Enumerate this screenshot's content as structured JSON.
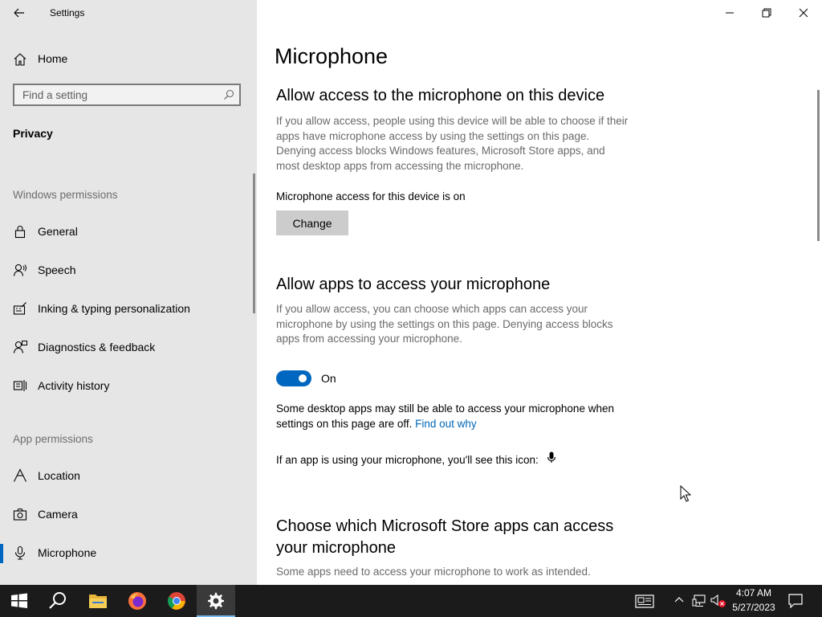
{
  "window": {
    "title": "Settings"
  },
  "sidebar": {
    "home_label": "Home",
    "search_placeholder": "Find a setting",
    "section_label": "Privacy",
    "group_windows": "Windows permissions",
    "group_apps": "App permissions",
    "windows_items": [
      {
        "label": "General",
        "icon": "lock-icon"
      },
      {
        "label": "Speech",
        "icon": "speech-icon"
      },
      {
        "label": "Inking & typing personalization",
        "icon": "inking-icon"
      },
      {
        "label": "Diagnostics & feedback",
        "icon": "diagnostics-icon"
      },
      {
        "label": "Activity history",
        "icon": "activity-history-icon"
      }
    ],
    "app_items": [
      {
        "label": "Location",
        "icon": "location-icon"
      },
      {
        "label": "Camera",
        "icon": "camera-icon"
      },
      {
        "label": "Microphone",
        "icon": "microphone-icon",
        "selected": true
      }
    ]
  },
  "main": {
    "page_title": "Microphone",
    "device_section": {
      "heading": "Allow access to the microphone on this device",
      "description": "If you allow access, people using this device will be able to choose if their apps have microphone access by using the settings on this page. Denying access blocks Windows features, Microsoft Store apps, and most desktop apps from accessing the microphone.",
      "status": "Microphone access for this device is on",
      "change_label": "Change"
    },
    "apps_section": {
      "heading": "Allow apps to access your microphone",
      "description": "If you allow access, you can choose which apps can access your microphone by using the settings on this page. Denying access blocks apps from accessing your microphone.",
      "toggle_state": "On",
      "toggle_on": true,
      "desktop_note": "Some desktop apps may still be able to access your microphone when settings on this page are off.",
      "find_out_link": "Find out why",
      "icon_note": "If an app is using your microphone, you'll see this icon:"
    },
    "store_section": {
      "heading_line1": "Choose which Microsoft Store apps can access",
      "heading_line2": "your microphone",
      "description": "Some apps need to access your microphone to work as intended."
    }
  },
  "taskbar": {
    "apps": [
      "start-button",
      "search-button",
      "file-explorer",
      "firefox",
      "chrome",
      "settings"
    ],
    "time": "4:07 AM",
    "date": "5/27/2023"
  },
  "colors": {
    "accent": "#0067c0",
    "link": "#0067b8",
    "sidebar_bg": "#e6e6e6",
    "taskbar_bg": "#1b1b1b"
  }
}
